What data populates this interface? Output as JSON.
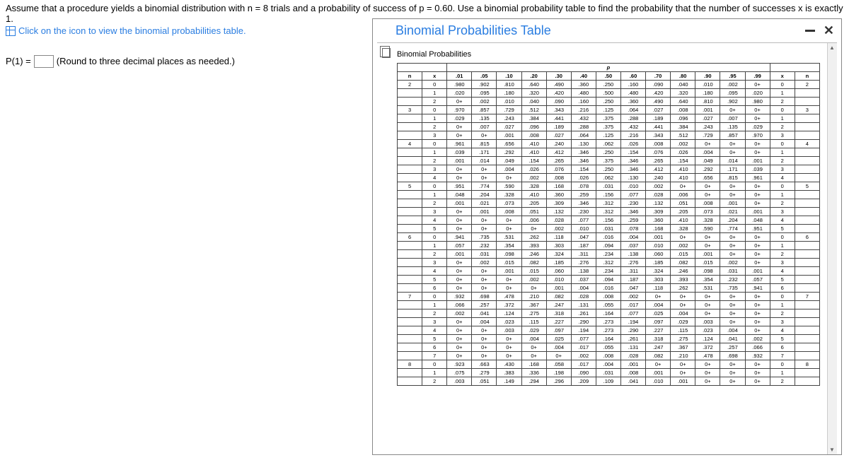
{
  "question": {
    "line1": "Assume that a procedure yields a binomial distribution with n = 8 trials and a probability of success of p = 0.60. Use a binomial probability table to find the probability that the number of successes x is exactly 1.",
    "linkText": "Click on the icon to view the binomial probabilities table."
  },
  "answer": {
    "prefix": "P(1) =",
    "suffix": "(Round to three decimal places as needed.)"
  },
  "modal": {
    "title": "Binomial Probabilities Table",
    "caption": "Binomial Probabilities"
  },
  "chart_data": {
    "type": "table",
    "p_header": "p",
    "columns_left": [
      "n",
      "x"
    ],
    "p_values": [
      ".01",
      ".05",
      ".10",
      ".20",
      ".30",
      ".40",
      ".50",
      ".60",
      ".70",
      ".80",
      ".90",
      ".95",
      ".99"
    ],
    "columns_right": [
      "x",
      "n"
    ],
    "groups": [
      {
        "n": 2,
        "rows": [
          {
            "x": 0,
            "v": [
              ".980",
              ".902",
              ".810",
              ".640",
              ".490",
              ".360",
              ".250",
              ".160",
              ".090",
              ".040",
              ".010",
              ".002",
              "0+"
            ]
          },
          {
            "x": 1,
            "v": [
              ".020",
              ".095",
              ".180",
              ".320",
              ".420",
              ".480",
              ".500",
              ".480",
              ".420",
              ".320",
              ".180",
              ".095",
              ".020"
            ]
          },
          {
            "x": 2,
            "v": [
              "0+",
              ".002",
              ".010",
              ".040",
              ".090",
              ".160",
              ".250",
              ".360",
              ".490",
              ".640",
              ".810",
              ".902",
              ".980"
            ]
          }
        ]
      },
      {
        "n": 3,
        "rows": [
          {
            "x": 0,
            "v": [
              ".970",
              ".857",
              ".729",
              ".512",
              ".343",
              ".216",
              ".125",
              ".064",
              ".027",
              ".008",
              ".001",
              "0+",
              "0+"
            ]
          },
          {
            "x": 1,
            "v": [
              ".029",
              ".135",
              ".243",
              ".384",
              ".441",
              ".432",
              ".375",
              ".288",
              ".189",
              ".096",
              ".027",
              ".007",
              "0+"
            ]
          },
          {
            "x": 2,
            "v": [
              "0+",
              ".007",
              ".027",
              ".096",
              ".189",
              ".288",
              ".375",
              ".432",
              ".441",
              ".384",
              ".243",
              ".135",
              ".029"
            ]
          },
          {
            "x": 3,
            "v": [
              "0+",
              "0+",
              ".001",
              ".008",
              ".027",
              ".064",
              ".125",
              ".216",
              ".343",
              ".512",
              ".729",
              ".857",
              ".970"
            ]
          }
        ]
      },
      {
        "n": 4,
        "rows": [
          {
            "x": 0,
            "v": [
              ".961",
              ".815",
              ".656",
              ".410",
              ".240",
              ".130",
              ".062",
              ".026",
              ".008",
              ".002",
              "0+",
              "0+",
              "0+"
            ]
          },
          {
            "x": 1,
            "v": [
              ".039",
              ".171",
              ".292",
              ".410",
              ".412",
              ".346",
              ".250",
              ".154",
              ".076",
              ".026",
              ".004",
              "0+",
              "0+"
            ]
          },
          {
            "x": 2,
            "v": [
              ".001",
              ".014",
              ".049",
              ".154",
              ".265",
              ".346",
              ".375",
              ".346",
              ".265",
              ".154",
              ".049",
              ".014",
              ".001"
            ]
          },
          {
            "x": 3,
            "v": [
              "0+",
              "0+",
              ".004",
              ".026",
              ".076",
              ".154",
              ".250",
              ".346",
              ".412",
              ".410",
              ".292",
              ".171",
              ".039"
            ]
          },
          {
            "x": 4,
            "v": [
              "0+",
              "0+",
              "0+",
              ".002",
              ".008",
              ".026",
              ".062",
              ".130",
              ".240",
              ".410",
              ".656",
              ".815",
              ".961"
            ]
          }
        ]
      },
      {
        "n": 5,
        "rows": [
          {
            "x": 0,
            "v": [
              ".951",
              ".774",
              ".590",
              ".328",
              ".168",
              ".078",
              ".031",
              ".010",
              ".002",
              "0+",
              "0+",
              "0+",
              "0+"
            ]
          },
          {
            "x": 1,
            "v": [
              ".048",
              ".204",
              ".328",
              ".410",
              ".360",
              ".259",
              ".156",
              ".077",
              ".028",
              ".006",
              "0+",
              "0+",
              "0+"
            ]
          },
          {
            "x": 2,
            "v": [
              ".001",
              ".021",
              ".073",
              ".205",
              ".309",
              ".346",
              ".312",
              ".230",
              ".132",
              ".051",
              ".008",
              ".001",
              "0+"
            ]
          },
          {
            "x": 3,
            "v": [
              "0+",
              ".001",
              ".008",
              ".051",
              ".132",
              ".230",
              ".312",
              ".346",
              ".309",
              ".205",
              ".073",
              ".021",
              ".001"
            ]
          },
          {
            "x": 4,
            "v": [
              "0+",
              "0+",
              "0+",
              ".006",
              ".028",
              ".077",
              ".156",
              ".259",
              ".360",
              ".410",
              ".328",
              ".204",
              ".048"
            ]
          },
          {
            "x": 5,
            "v": [
              "0+",
              "0+",
              "0+",
              "0+",
              ".002",
              ".010",
              ".031",
              ".078",
              ".168",
              ".328",
              ".590",
              ".774",
              ".951"
            ]
          }
        ]
      },
      {
        "n": 6,
        "rows": [
          {
            "x": 0,
            "v": [
              ".941",
              ".735",
              ".531",
              ".262",
              ".118",
              ".047",
              ".016",
              ".004",
              ".001",
              "0+",
              "0+",
              "0+",
              "0+"
            ]
          },
          {
            "x": 1,
            "v": [
              ".057",
              ".232",
              ".354",
              ".393",
              ".303",
              ".187",
              ".094",
              ".037",
              ".010",
              ".002",
              "0+",
              "0+",
              "0+"
            ]
          },
          {
            "x": 2,
            "v": [
              ".001",
              ".031",
              ".098",
              ".246",
              ".324",
              ".311",
              ".234",
              ".138",
              ".060",
              ".015",
              ".001",
              "0+",
              "0+"
            ]
          },
          {
            "x": 3,
            "v": [
              "0+",
              ".002",
              ".015",
              ".082",
              ".185",
              ".276",
              ".312",
              ".276",
              ".185",
              ".082",
              ".015",
              ".002",
              "0+"
            ]
          },
          {
            "x": 4,
            "v": [
              "0+",
              "0+",
              ".001",
              ".015",
              ".060",
              ".138",
              ".234",
              ".311",
              ".324",
              ".246",
              ".098",
              ".031",
              ".001"
            ]
          },
          {
            "x": 5,
            "v": [
              "0+",
              "0+",
              "0+",
              ".002",
              ".010",
              ".037",
              ".094",
              ".187",
              ".303",
              ".393",
              ".354",
              ".232",
              ".057"
            ]
          },
          {
            "x": 6,
            "v": [
              "0+",
              "0+",
              "0+",
              "0+",
              ".001",
              ".004",
              ".016",
              ".047",
              ".118",
              ".262",
              ".531",
              ".735",
              ".941"
            ]
          }
        ]
      },
      {
        "n": 7,
        "rows": [
          {
            "x": 0,
            "v": [
              ".932",
              ".698",
              ".478",
              ".210",
              ".082",
              ".028",
              ".008",
              ".002",
              "0+",
              "0+",
              "0+",
              "0+",
              "0+"
            ]
          },
          {
            "x": 1,
            "v": [
              ".066",
              ".257",
              ".372",
              ".367",
              ".247",
              ".131",
              ".055",
              ".017",
              ".004",
              "0+",
              "0+",
              "0+",
              "0+"
            ]
          },
          {
            "x": 2,
            "v": [
              ".002",
              ".041",
              ".124",
              ".275",
              ".318",
              ".261",
              ".164",
              ".077",
              ".025",
              ".004",
              "0+",
              "0+",
              "0+"
            ]
          },
          {
            "x": 3,
            "v": [
              "0+",
              ".004",
              ".023",
              ".115",
              ".227",
              ".290",
              ".273",
              ".194",
              ".097",
              ".029",
              ".003",
              "0+",
              "0+"
            ]
          },
          {
            "x": 4,
            "v": [
              "0+",
              "0+",
              ".003",
              ".029",
              ".097",
              ".194",
              ".273",
              ".290",
              ".227",
              ".115",
              ".023",
              ".004",
              "0+"
            ]
          },
          {
            "x": 5,
            "v": [
              "0+",
              "0+",
              "0+",
              ".004",
              ".025",
              ".077",
              ".164",
              ".261",
              ".318",
              ".275",
              ".124",
              ".041",
              ".002"
            ]
          },
          {
            "x": 6,
            "v": [
              "0+",
              "0+",
              "0+",
              "0+",
              ".004",
              ".017",
              ".055",
              ".131",
              ".247",
              ".367",
              ".372",
              ".257",
              ".066"
            ]
          },
          {
            "x": 7,
            "v": [
              "0+",
              "0+",
              "0+",
              "0+",
              "0+",
              ".002",
              ".008",
              ".028",
              ".082",
              ".210",
              ".478",
              ".698",
              ".932"
            ]
          }
        ]
      },
      {
        "n": 8,
        "rows": [
          {
            "x": 0,
            "v": [
              ".923",
              ".663",
              ".430",
              ".168",
              ".058",
              ".017",
              ".004",
              ".001",
              "0+",
              "0+",
              "0+",
              "0+",
              "0+"
            ]
          },
          {
            "x": 1,
            "v": [
              ".075",
              ".279",
              ".383",
              ".336",
              ".198",
              ".090",
              ".031",
              ".008",
              ".001",
              "0+",
              "0+",
              "0+",
              "0+"
            ]
          },
          {
            "x": 2,
            "v": [
              ".003",
              ".051",
              ".149",
              ".294",
              ".296",
              ".209",
              ".109",
              ".041",
              ".010",
              ".001",
              "0+",
              "0+",
              "0+"
            ]
          }
        ]
      }
    ]
  }
}
